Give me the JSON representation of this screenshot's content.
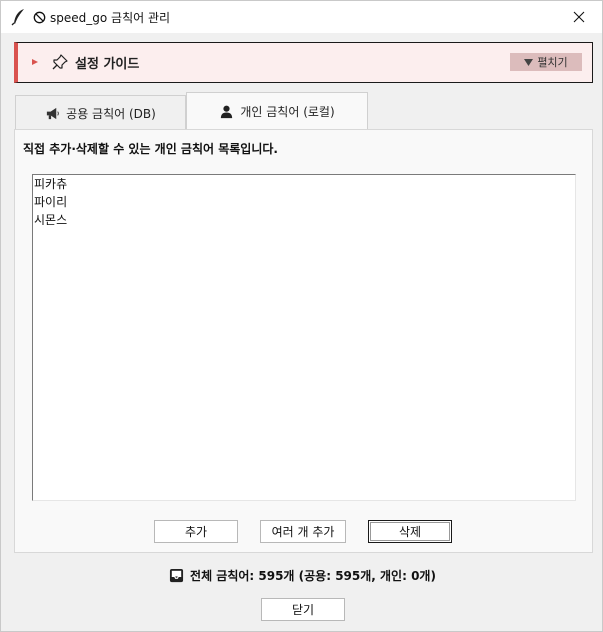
{
  "window": {
    "title": "speed_go 금칙어 관리",
    "close_label": "×"
  },
  "guide": {
    "title": "설정 가이드",
    "expand_label": "펼치기"
  },
  "tabs": [
    {
      "label": "공용 금칙어 (DB)",
      "selected": false
    },
    {
      "label": "개인 금칙어 (로컬)",
      "selected": true
    }
  ],
  "panel": {
    "description": "직접 추가·삭제할 수 있는 개인 금칙어 목록입니다.",
    "items": [
      "피카츄",
      "파이리",
      "시몬스"
    ]
  },
  "buttons": {
    "add": "추가",
    "bulk_add": "여러 개 추가",
    "delete": "삭제",
    "close": "닫기"
  },
  "summary": {
    "text": "전체 금칙어: 595개 (공용: 595개, 개인: 0개)"
  },
  "colors": {
    "guide_accent": "#d9534f",
    "guide_bg": "#fceeee",
    "expand_bg": "#dcbcbc"
  }
}
